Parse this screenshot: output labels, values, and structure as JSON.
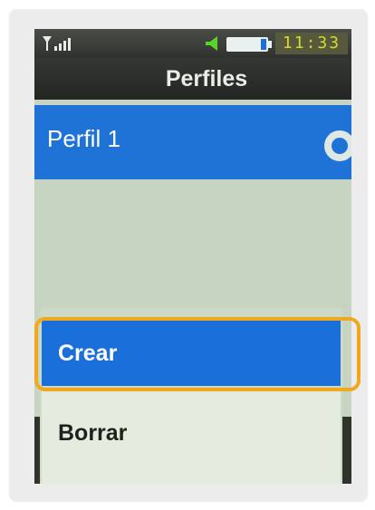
{
  "status_bar": {
    "time": "11:33",
    "icons": [
      "signal-icon",
      "speaker-icon",
      "battery-icon"
    ],
    "battery_level": 0.15
  },
  "header": {
    "title": "Perfiles"
  },
  "profiles": [
    {
      "label": "Perfil 1",
      "selected": true
    }
  ],
  "popup_menu": {
    "items": [
      {
        "label": "Crear",
        "highlighted": true
      },
      {
        "label": "Borrar",
        "highlighted": false
      }
    ]
  },
  "colors": {
    "accent_blue": "#1f73d6",
    "highlight_orange": "#f2a81c",
    "clock_text": "#d6d92c"
  }
}
